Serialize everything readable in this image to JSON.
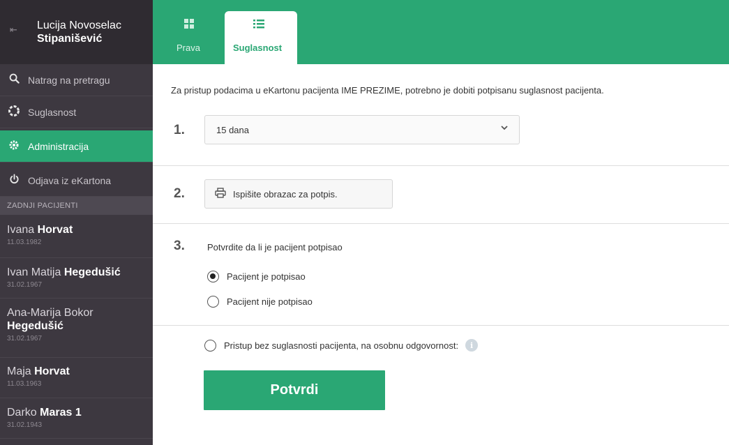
{
  "user": {
    "first_name": "Lucija Novoselac",
    "last_name": "Stipanišević"
  },
  "menu": {
    "items": [
      {
        "label": "Natrag na pretragu",
        "icon": "search-icon"
      },
      {
        "label": "Suglasnost",
        "icon": "consent-icon"
      },
      {
        "label": "Administracija",
        "icon": "gear-icon",
        "active": true
      },
      {
        "label": "Odjava iz eKartona",
        "icon": "power-icon"
      }
    ]
  },
  "recent": {
    "title": "ZADNJI PACIJENTI",
    "patients": [
      {
        "first": "Ivana ",
        "last": "Horvat",
        "date": "11.03.1982"
      },
      {
        "first": "Ivan Matija ",
        "last": "Hegedušić",
        "date": "31.02.1967"
      },
      {
        "first": "Ana-Marija Bokor",
        "last": "Hegedušić",
        "date": "31.02.1967"
      },
      {
        "first": "Maja ",
        "last": "Horvat",
        "date": "11.03.1963"
      },
      {
        "first": "Darko ",
        "last": "Maras 1",
        "date": "31.02.1943"
      }
    ]
  },
  "tabs": [
    {
      "label": "Prava",
      "icon": "grid-icon"
    },
    {
      "label": "Suglasnost",
      "icon": "list-icon",
      "active": true
    }
  ],
  "content": {
    "intro": "Za pristup podacima u eKartonu pacijenta IME PREZIME, potrebno je dobiti potpisanu suglasnost pacijenta.",
    "step1": {
      "number": "1.",
      "selected": "15 dana"
    },
    "step2": {
      "number": "2.",
      "button": "Ispišite obrazac za potpis."
    },
    "step3": {
      "number": "3.",
      "question": "Potvrdite da li je pacijent potpisao",
      "options": [
        {
          "label": "Pacijent je potpisao",
          "checked": true
        },
        {
          "label": "Pacijent nije potpisao",
          "checked": false
        }
      ]
    },
    "override": {
      "label": "Pristup bez suglasnosti pacijenta, na osobnu odgovornost:",
      "checked": false
    },
    "confirm": "Potvrdi"
  },
  "colors": {
    "accent": "#2aa774",
    "sidebar": "#3d3840",
    "sidebar_header": "#2f2b31"
  }
}
